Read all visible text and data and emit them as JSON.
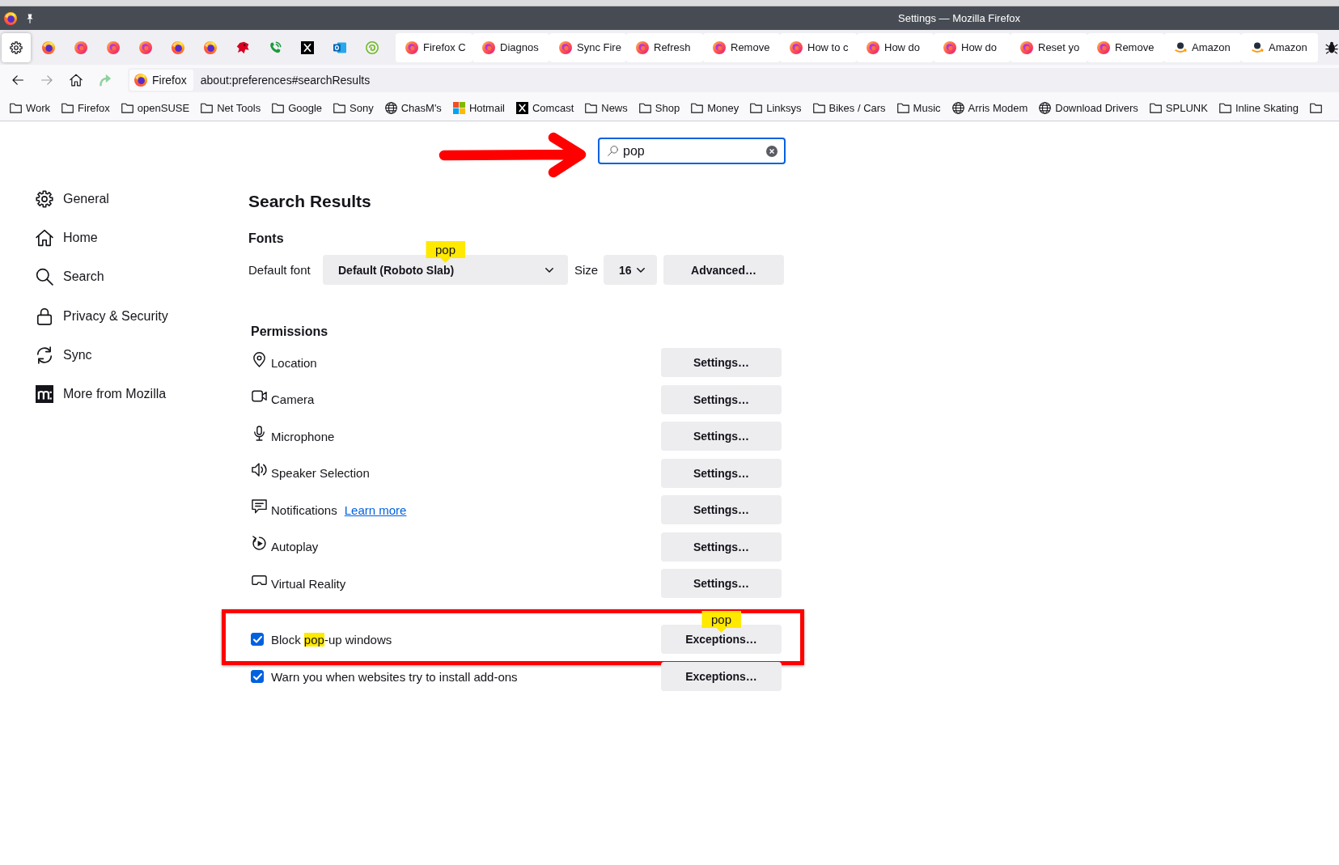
{
  "title_bar": {
    "title": "Settings — Mozilla Firefox"
  },
  "tabs": [
    {
      "kind": "settings",
      "selected": true
    },
    {
      "kind": "pinned",
      "selected": false
    },
    {
      "kind": "pinned",
      "selected": false
    },
    {
      "kind": "pinned",
      "selected": false
    },
    {
      "kind": "pinned",
      "selected": false
    },
    {
      "kind": "pinned",
      "selected": false
    },
    {
      "kind": "pinned",
      "selected": false
    },
    {
      "kind": "pinned",
      "selected": false
    },
    {
      "kind": "pinned",
      "selected": false
    },
    {
      "kind": "pinned",
      "selected": false
    },
    {
      "kind": "pinned",
      "selected": false
    },
    {
      "kind": "pinned",
      "selected": false
    },
    {
      "kind": "page",
      "label": "Firefox C",
      "selected": false
    },
    {
      "kind": "page",
      "label": "Diagnos",
      "selected": false
    },
    {
      "kind": "page",
      "label": "Sync Fire",
      "selected": false
    },
    {
      "kind": "page",
      "label": "Refresh",
      "selected": false
    },
    {
      "kind": "page",
      "label": "Remove",
      "selected": false
    },
    {
      "kind": "page",
      "label": "How to c",
      "selected": false
    },
    {
      "kind": "page",
      "label": "How do",
      "selected": false
    },
    {
      "kind": "page",
      "label": "How do",
      "selected": false
    },
    {
      "kind": "page",
      "label": "Reset yo",
      "selected": false
    },
    {
      "kind": "page",
      "label": "Remove",
      "selected": false
    },
    {
      "kind": "page",
      "label": "Amazon",
      "selected": false
    },
    {
      "kind": "page",
      "label": "Amazon",
      "selected": false
    },
    {
      "kind": "cutoff",
      "selected": false
    }
  ],
  "nav_buttons": [
    {
      "kind": "back",
      "disabled": false
    },
    {
      "kind": "forward",
      "disabled": true
    },
    {
      "kind": "home",
      "disabled": false
    },
    {
      "kind": "extension",
      "disabled": false
    }
  ],
  "address_bar": {
    "identity": "Firefox",
    "url": "about:preferences#searchResults"
  },
  "bookmarks": [
    {
      "kind": "folder",
      "label": "Work"
    },
    {
      "kind": "folder",
      "label": "Firefox"
    },
    {
      "kind": "folder",
      "label": "openSUSE"
    },
    {
      "kind": "folder",
      "label": "Net Tools"
    },
    {
      "kind": "folder",
      "label": "Google"
    },
    {
      "kind": "folder",
      "label": "Sony"
    },
    {
      "kind": "globe",
      "label": "ChasM's"
    },
    {
      "kind": "tiles",
      "label": "Hotmail"
    },
    {
      "kind": "xmark",
      "label": "Comcast"
    },
    {
      "kind": "folder",
      "label": "News"
    },
    {
      "kind": "folder",
      "label": "Shop"
    },
    {
      "kind": "folder",
      "label": "Money"
    },
    {
      "kind": "folder",
      "label": "Linksys"
    },
    {
      "kind": "folder",
      "label": "Bikes / Cars"
    },
    {
      "kind": "folder",
      "label": "Music"
    },
    {
      "kind": "globe",
      "label": "Arris Modem"
    },
    {
      "kind": "globe",
      "label": "Download Drivers"
    },
    {
      "kind": "folder",
      "label": "SPLUNK"
    },
    {
      "kind": "folder",
      "label": "Inline Skating"
    },
    {
      "kind": "cutoff"
    }
  ],
  "search": {
    "value": "pop",
    "annotation_arrow": true
  },
  "sidebar": {
    "items": [
      {
        "label": "General",
        "selected": false
      },
      {
        "label": "Home",
        "selected": false
      },
      {
        "label": "Search",
        "selected": false
      },
      {
        "label": "Privacy & Security",
        "selected": false
      },
      {
        "label": "Sync",
        "selected": false
      },
      {
        "label": "More from Mozilla",
        "selected": false
      }
    ]
  },
  "heading": "Search Results",
  "fonts": {
    "heading": "Fonts",
    "default_font": {
      "label": "Default font",
      "value": "Default (Roboto Slab)",
      "tooltip": "pop"
    },
    "size": {
      "label": "Size",
      "value": "16"
    },
    "advanced_button": "Advanced…"
  },
  "permissions": {
    "heading": "Permissions",
    "rows": [
      {
        "label": "Location",
        "button": "Settings…"
      },
      {
        "label": "Camera",
        "button": "Settings…"
      },
      {
        "label": "Microphone",
        "button": "Settings…"
      },
      {
        "label": "Speaker Selection",
        "button": "Settings…"
      },
      {
        "label": "Notifications",
        "link": "Learn more",
        "button": "Settings…"
      },
      {
        "label": "Autoplay",
        "button": "Settings…"
      },
      {
        "label": "Virtual Reality",
        "button": "Settings…"
      }
    ]
  },
  "checkboxes": [
    {
      "label_parts": [
        {
          "text": "Block ",
          "highlighted": false
        },
        {
          "text": "pop",
          "highlighted": true
        },
        {
          "text": "-up windows",
          "highlighted": false
        }
      ],
      "checked": true,
      "button": "Exceptions…",
      "tooltip": "pop",
      "annotation_frame": true
    },
    {
      "label_parts": [
        {
          "text": "Warn you when websites try to install add-ons",
          "highlighted": false
        }
      ],
      "checked": true,
      "button": "Exceptions…",
      "annotation_frame": false
    }
  ]
}
